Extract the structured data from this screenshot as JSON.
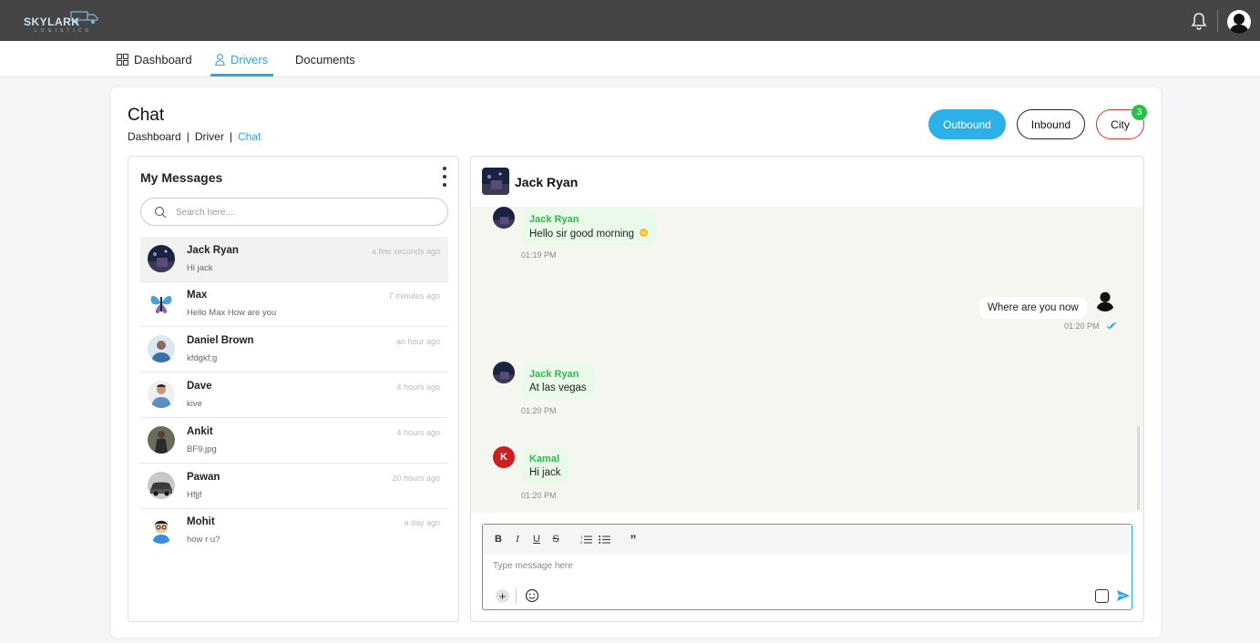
{
  "brand": {
    "name": "SKYLARK",
    "tagline": "LOGISTICS"
  },
  "nav": {
    "items": [
      {
        "label": "Dashboard",
        "icon": "grid-icon",
        "active": false
      },
      {
        "label": "Drivers",
        "icon": "user-icon",
        "active": true
      },
      {
        "label": "Documents",
        "icon": "",
        "active": false
      }
    ]
  },
  "page": {
    "title": "Chat",
    "breadcrumb": [
      "Dashboard",
      "Driver",
      "Chat"
    ]
  },
  "filters": {
    "outbound": "Outbound",
    "inbound": "Inbound",
    "city": "City",
    "city_badge": "3"
  },
  "messages_panel": {
    "title": "My Messages",
    "search_placeholder": "Search here....",
    "conversations": [
      {
        "name": "Jack Ryan",
        "last": "Hi jack",
        "time": "a few seconds ago",
        "avatar": "night-city-photo"
      },
      {
        "name": "Max",
        "last": "Hello Max How are you",
        "time": "7 minutes ago",
        "avatar": "butterfly-photo"
      },
      {
        "name": "Daniel Brown",
        "last": "kfdgkf;g",
        "time": "an hour ago",
        "avatar": "person-photo"
      },
      {
        "name": "Dave",
        "last": "kive",
        "time": "4 hours ago",
        "avatar": "man-blue-shirt-photo"
      },
      {
        "name": "Ankit",
        "last": "BF9.jpg",
        "time": "4 hours ago",
        "avatar": "person-dark-photo"
      },
      {
        "name": "Pawan",
        "last": "Hfjjf",
        "time": "20 hours ago",
        "avatar": "car-photo"
      },
      {
        "name": "Mohit",
        "last": "how r u?",
        "time": "a day ago",
        "avatar": "cartoon-man"
      }
    ]
  },
  "chat": {
    "contact_name": "Jack Ryan",
    "messages": [
      {
        "direction": "in",
        "sender": "Jack Ryan",
        "text": "Hello sir good morning",
        "emoji": "sun-emoji",
        "time": "01:19 PM"
      },
      {
        "direction": "out",
        "text": "Where are you now",
        "time": "01:20 PM"
      },
      {
        "direction": "in",
        "sender": "Jack Ryan",
        "text": "At las vegas",
        "time": "01:20 PM"
      },
      {
        "direction": "in",
        "sender": "Kamal",
        "initial": "K",
        "text": "Hi jack",
        "time": "01:20 PM"
      }
    ],
    "composer": {
      "placeholder": "Type message here",
      "toolbar": {
        "bold": "B",
        "italic": "I",
        "underline": "U",
        "strike": "S"
      }
    }
  },
  "colors": {
    "topbar": "#454545",
    "accent": "#2aa8e0",
    "outbound": "#2bb0e8",
    "city_border": "#dd3333",
    "badge": "#28c04a",
    "sender_green": "#2fba48",
    "bubble_in": "#e9f9ea",
    "kamal_avatar": "#cc1f1f"
  }
}
